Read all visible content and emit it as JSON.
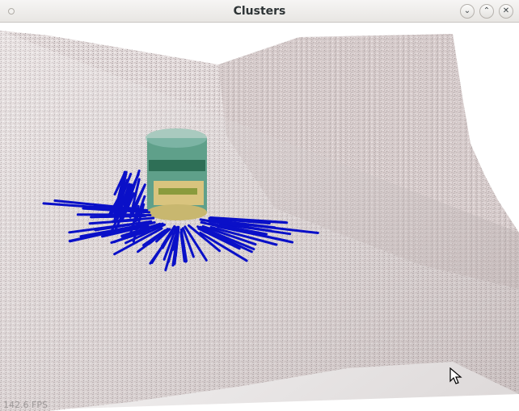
{
  "window": {
    "title": "Clusters",
    "buttons": {
      "minimize_icon": "chevron-down-icon",
      "maximize_icon": "chevron-up-icon",
      "close_icon": "close-icon",
      "minimize_glyph": "⌄",
      "maximize_glyph": "⌃",
      "close_glyph": "✕"
    }
  },
  "viewer": {
    "fps_text": "142.6 FPS",
    "colors": {
      "surface": "#d8cfcf",
      "surface_shadow": "#bfb3b3",
      "normals": "#0a10c8",
      "object_green": "#3f9a7a",
      "object_yellow": "#d8c27a"
    }
  }
}
